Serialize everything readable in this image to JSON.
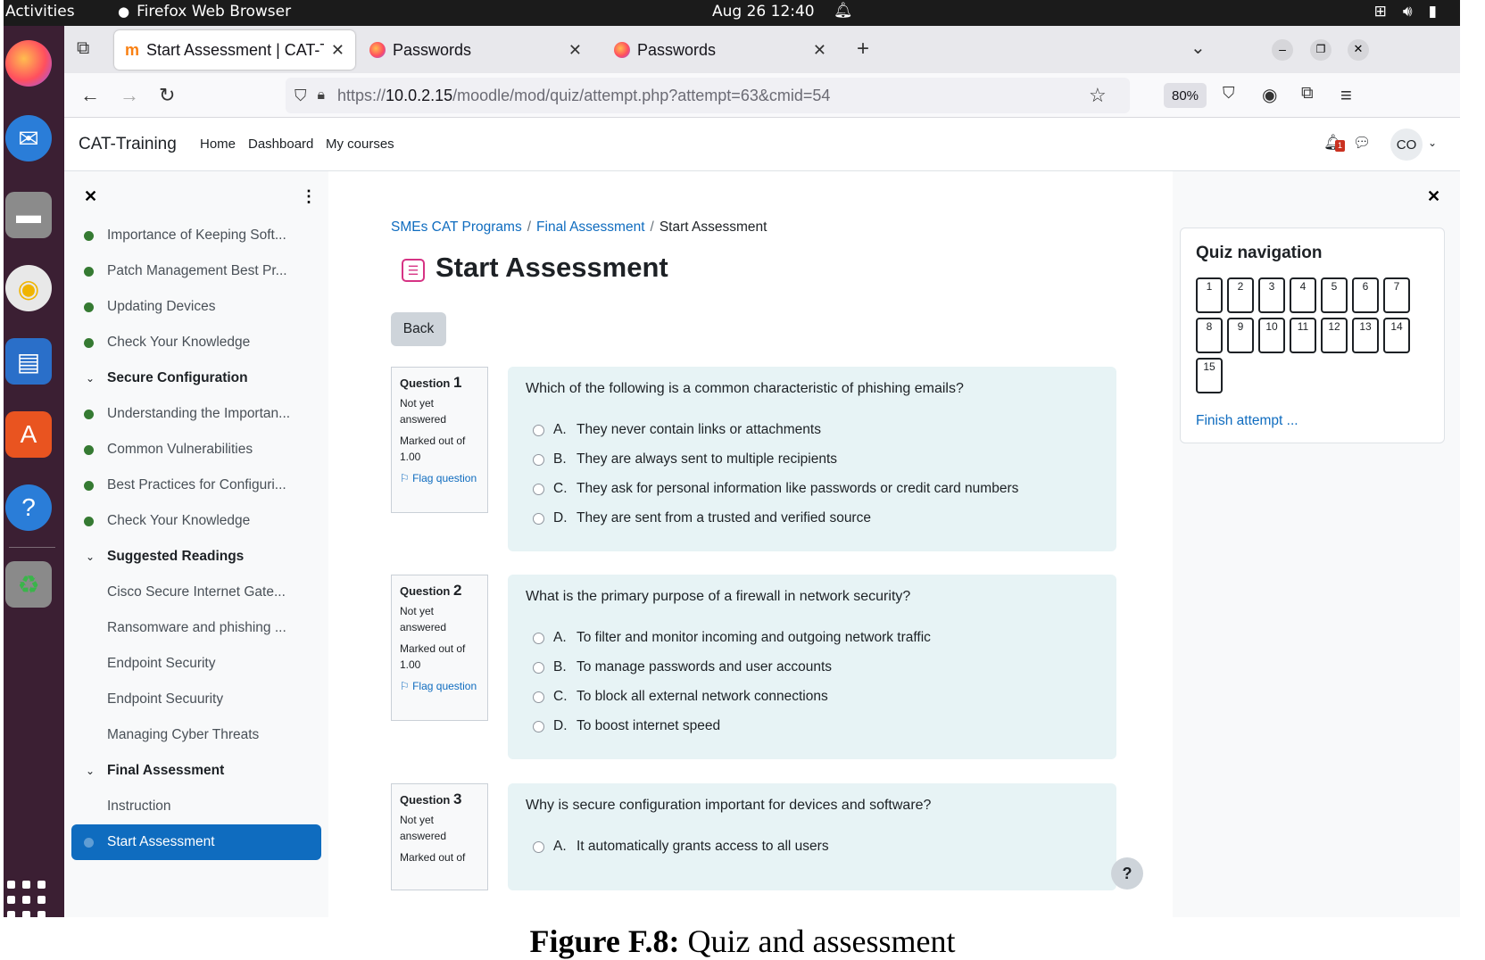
{
  "system": {
    "activities": "Activities",
    "app_name": "Firefox Web Browser",
    "clock": "Aug 26  12:40"
  },
  "browser": {
    "tabs": [
      {
        "label": "Start Assessment | CAT-T"
      },
      {
        "label": "Passwords"
      },
      {
        "label": "Passwords"
      }
    ],
    "url_prefix": "https://",
    "url_host": "10.0.2.15",
    "url_path": "/moodle/mod/quiz/attempt.php?attempt=63&cmid=54",
    "zoom": "80%"
  },
  "moodle": {
    "brand": "CAT-Training",
    "menu": [
      "Home",
      "Dashboard",
      "My courses"
    ],
    "notification_count": "1",
    "user_initials": "CO"
  },
  "course_index": [
    {
      "type": "item",
      "label": "Importance of Keeping Soft..."
    },
    {
      "type": "item",
      "label": "Patch Management Best Pr..."
    },
    {
      "type": "item",
      "label": "Updating Devices"
    },
    {
      "type": "item",
      "label": "Check Your Knowledge"
    },
    {
      "type": "section",
      "label": "Secure Configuration"
    },
    {
      "type": "item",
      "label": "Understanding the Importan..."
    },
    {
      "type": "item",
      "label": "Common Vulnerabilities"
    },
    {
      "type": "item",
      "label": "Best Practices for Configuri..."
    },
    {
      "type": "item",
      "label": "Check Your Knowledge"
    },
    {
      "type": "section",
      "label": "Suggested Readings"
    },
    {
      "type": "plain",
      "label": "Cisco Secure Internet Gate..."
    },
    {
      "type": "plain",
      "label": "Ransomware and phishing ..."
    },
    {
      "type": "plain",
      "label": "Endpoint Security"
    },
    {
      "type": "plain",
      "label": "Endpoint Secuurity"
    },
    {
      "type": "plain",
      "label": "Managing Cyber Threats"
    },
    {
      "type": "section",
      "label": "Final Assessment"
    },
    {
      "type": "plain",
      "label": "Instruction"
    },
    {
      "type": "active",
      "label": "Start Assessment"
    }
  ],
  "breadcrumb": [
    "SMEs CAT Programs",
    "Final Assessment",
    "Start Assessment"
  ],
  "page_title": "Start Assessment",
  "back_label": "Back",
  "questions": [
    {
      "label": "Question",
      "number": "1",
      "status": "Not yet answered",
      "marked": "Marked out of 1.00",
      "flag": "Flag question",
      "text": "Which of the following is a common characteristic of phishing emails?",
      "answers": [
        {
          "letter": "A.",
          "text": "They never contain links or attachments"
        },
        {
          "letter": "B.",
          "text": "They are always sent to multiple recipients"
        },
        {
          "letter": "C.",
          "text": "They ask for personal information like passwords or credit card numbers"
        },
        {
          "letter": "D.",
          "text": "They are sent from a trusted and verified source"
        }
      ]
    },
    {
      "label": "Question",
      "number": "2",
      "status": "Not yet answered",
      "marked": "Marked out of 1.00",
      "flag": "Flag question",
      "text": "What is the primary purpose of a firewall in network security?",
      "answers": [
        {
          "letter": "A.",
          "text": "To filter and monitor incoming and outgoing network traffic"
        },
        {
          "letter": "B.",
          "text": "To manage passwords and user accounts"
        },
        {
          "letter": "C.",
          "text": "To block all external network connections"
        },
        {
          "letter": "D.",
          "text": "To boost internet speed"
        }
      ]
    },
    {
      "label": "Question",
      "number": "3",
      "status": "Not yet answered",
      "marked": "Marked out of",
      "text": "Why is secure configuration important for devices and software?",
      "answers": [
        {
          "letter": "A.",
          "text": "It automatically grants access to all users"
        }
      ]
    }
  ],
  "quiz_nav": {
    "heading": "Quiz navigation",
    "numbers": [
      "1",
      "2",
      "3",
      "4",
      "5",
      "6",
      "7",
      "8",
      "9",
      "10",
      "11",
      "12",
      "13",
      "14",
      "15"
    ],
    "finish": "Finish attempt ..."
  },
  "caption": {
    "bold": "Figure F.8:",
    "text": " Quiz and assessment"
  }
}
